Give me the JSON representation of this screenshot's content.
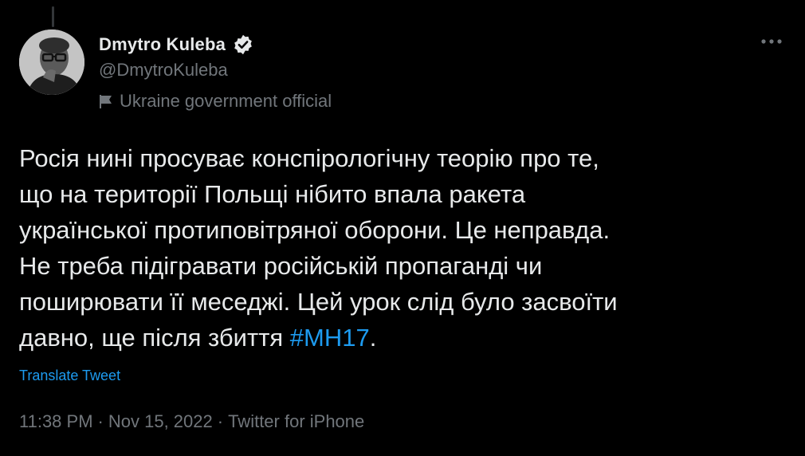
{
  "tweet": {
    "author": {
      "display_name": "Dmytro Kuleba",
      "handle": "@DmytroKuleba",
      "verified_icon": "verified-badge-icon",
      "label": "Ukraine government official",
      "label_icon": "government-flag-icon"
    },
    "more_icon": "more-options-icon",
    "text_main": "Росія нині просуває конспірологічну теорію про те,\nщо на території Польщі нібито впала ракета\nукраїнської протиповітряної оборони. Це неправда.\nНе треба підігравати російській пропаганді чи\nпоширювати її меседжі. Цей урок слід було засвоїти\nдавно, ще після збиття ",
    "hashtag": "#MH17",
    "text_end": ".",
    "translate_label": "Translate Tweet",
    "time": "11:38 PM",
    "separator": "·",
    "date": "Nov 15, 2022",
    "source": "Twitter for iPhone"
  },
  "colors": {
    "background": "#000000",
    "text": "#e7e9ea",
    "secondary": "#71767b",
    "accent": "#1d9bf0"
  }
}
